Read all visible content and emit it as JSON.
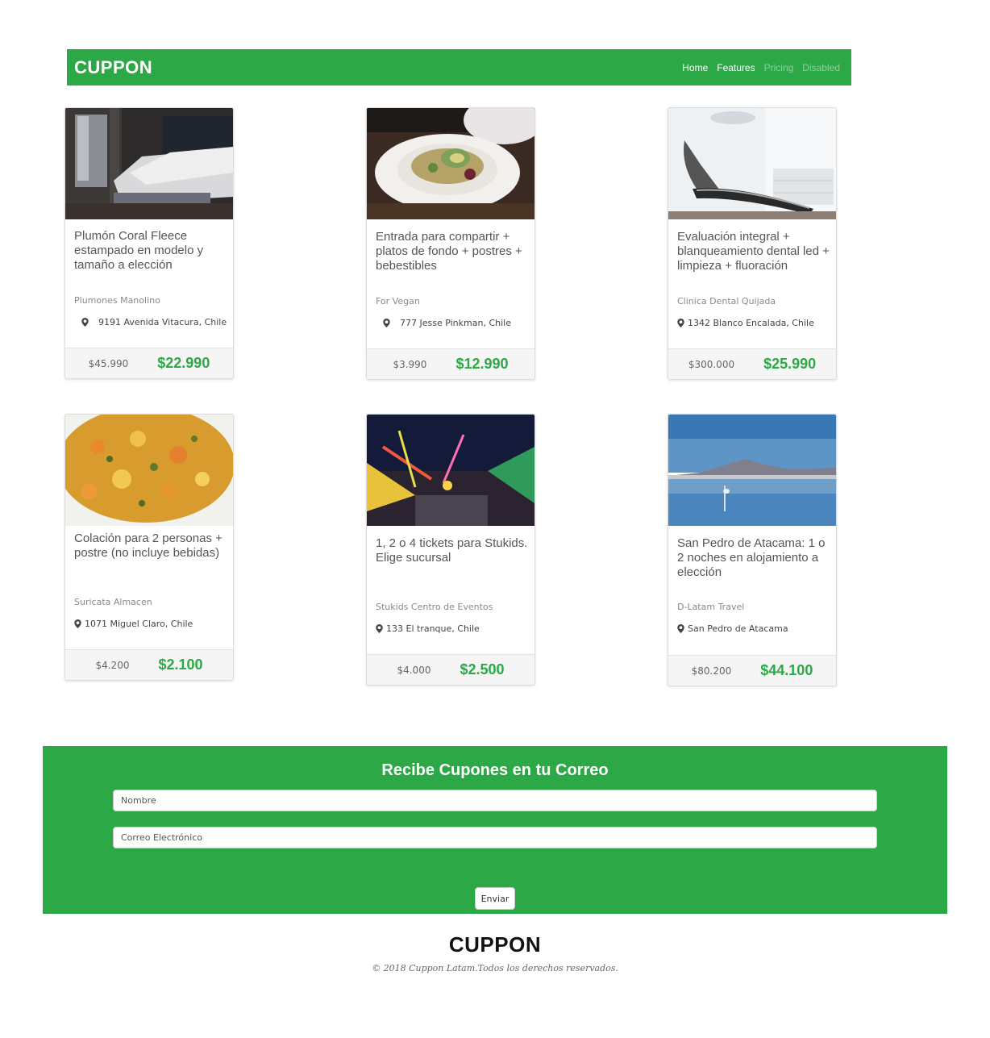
{
  "navbar": {
    "brand": "CUPPON",
    "links": [
      "Home",
      "Features",
      "Pricing",
      "Disabled"
    ]
  },
  "cards": [
    {
      "title": "Plumón Coral Fleece estampado en modelo y tamaño a elección",
      "vendor": "Plumones Manolino",
      "address": "9191 Avenida Vitacura, Chile",
      "old_price": "$45.990",
      "new_price": "$22.990"
    },
    {
      "title": "Entrada para compartir + platos de fondo + postres + bebestibles",
      "vendor": "For Vegan",
      "address": "777 Jesse Pinkman, Chile",
      "old_price": "$3.990",
      "new_price": "$12.990"
    },
    {
      "title": "Evaluación integral + blanqueamiento dental led + limpieza + fluoración",
      "vendor": "Clinica Dental Quijada",
      "address": "1342 Blanco Encalada, Chile",
      "old_price": "$300.000",
      "new_price": "$25.990"
    },
    {
      "title": "Colación para 2 personas + postre (no incluye bebidas)",
      "vendor": "Suricata Almacen",
      "address": "1071 Miguel Claro, Chile",
      "old_price": "$4.200",
      "new_price": "$2.100"
    },
    {
      "title": "1, 2 o 4 tickets para Stukids. Elige sucursal",
      "vendor": "Stukids Centro de Eventos",
      "address": "133 El tranque, Chile",
      "old_price": "$4.000",
      "new_price": "$2.500"
    },
    {
      "title": "San Pedro de Atacama: 1 o 2 noches en alojamiento a elección",
      "vendor": "D-Latam Travel",
      "address": "San Pedro de Atacama",
      "old_price": "$80.200",
      "new_price": "$44.100"
    }
  ],
  "subscribe": {
    "title": "Recibe Cupones en tu Correo",
    "name_placeholder": "Nombre",
    "email_placeholder": "Correo Electrónico",
    "submit_label": "Enviar"
  },
  "footer": {
    "brand": "CUPPON",
    "copyright": "© 2018 Cuppon Latam.Todos los derechos reservados."
  },
  "colors": {
    "accent": "#2ca846"
  }
}
